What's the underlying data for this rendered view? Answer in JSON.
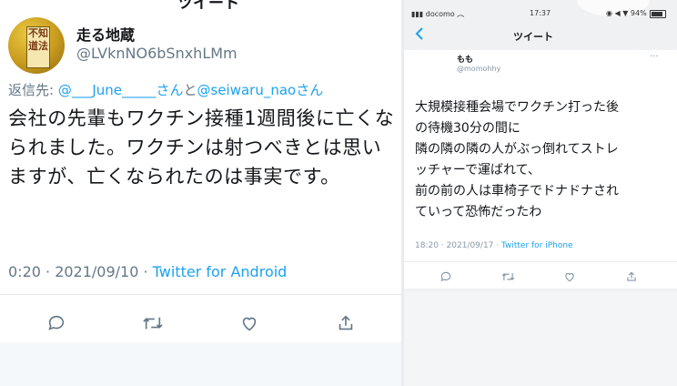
{
  "left_tweet": {
    "top_title": "ツイート",
    "avatar_text": "不知道法",
    "display_name": "走る地蔵",
    "handle": "@LVknNO6bSnxhLMm",
    "reply_prefix": "返信先: ",
    "reply_link_1": "@___June_____さん",
    "reply_sep": "と",
    "reply_link_2": "@seiwaru_naoさん",
    "text": "会社の先輩もワクチン接種1週間後に亡くなられました。ワクチンは射つべきとは思いますが、亡くなられたのは事実です。",
    "timestamp": "0:20 · 2021/09/10 · ",
    "client": "Twitter for Android",
    "colors": {
      "link": "#1da1f2",
      "muted": "#657786"
    }
  },
  "right_tweet": {
    "status": {
      "carrier": "docomo",
      "time": "17:37",
      "battery": "94%"
    },
    "nav_title": "ツイート",
    "display_name": "もも",
    "handle": "@momohhy",
    "more": "···",
    "lines": [
      "大規模接種会場でワクチン打った後",
      "の待機30分の間に",
      "隣の隣の隣の人がぶっ倒れてストレ",
      "ッチャーで運ばれて、",
      "前の前の人は車椅子でドナドナされ",
      "ていって恐怖だったわ"
    ],
    "timestamp": "18:20 · 2021/09/17 · ",
    "client": "Twitter for iPhone"
  },
  "icons": [
    "reply-icon",
    "retweet-icon",
    "like-icon",
    "share-icon",
    "back-chevron-icon"
  ]
}
